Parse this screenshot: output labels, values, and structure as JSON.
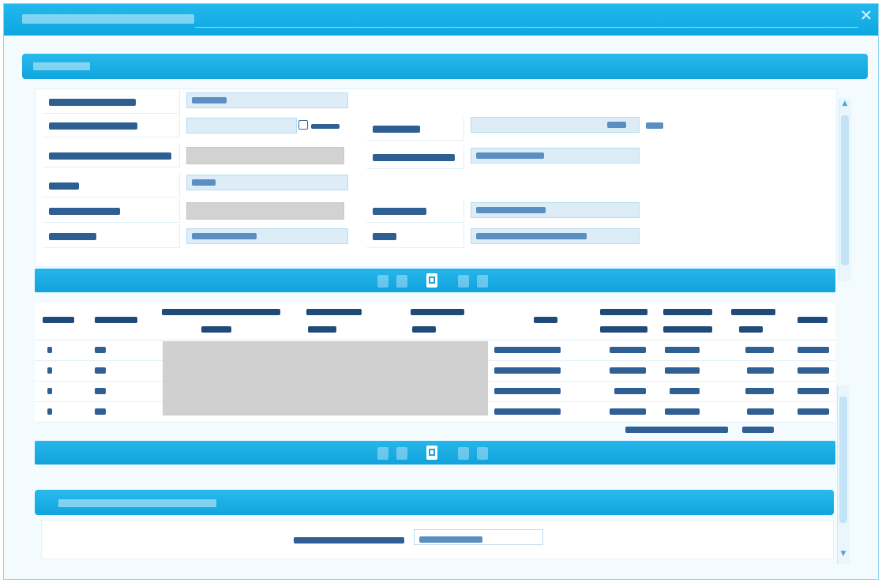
{
  "window": {
    "title": "",
    "close": "×"
  },
  "main_panel": {
    "title": ""
  },
  "form": {
    "labels": [
      "",
      "",
      "",
      "",
      "",
      "",
      "",
      "",
      "",
      "",
      ""
    ],
    "values": [
      "",
      "",
      "",
      "",
      "",
      "",
      "",
      "",
      "",
      "",
      ""
    ]
  },
  "table": {
    "headers": [
      "",
      "",
      "",
      "",
      "",
      "",
      "",
      "",
      "",
      "",
      ""
    ],
    "subheaders": [
      "",
      "",
      "",
      "",
      "",
      "",
      "",
      "",
      "",
      ""
    ],
    "rows": [
      [
        "",
        "",
        "",
        "",
        "",
        "",
        "",
        ""
      ],
      [
        "",
        "",
        "",
        "",
        "",
        "",
        "",
        ""
      ],
      [
        "",
        "",
        "",
        "",
        "",
        "",
        "",
        ""
      ],
      [
        "",
        "",
        "",
        "",
        "",
        "",
        "",
        ""
      ]
    ],
    "total_label": "",
    "total_value": ""
  },
  "pager": {
    "icon": "page-icon"
  },
  "section2": {
    "title": "",
    "field_label": "",
    "field_value": ""
  },
  "scroll": {
    "up": "▲",
    "down": "▼"
  }
}
